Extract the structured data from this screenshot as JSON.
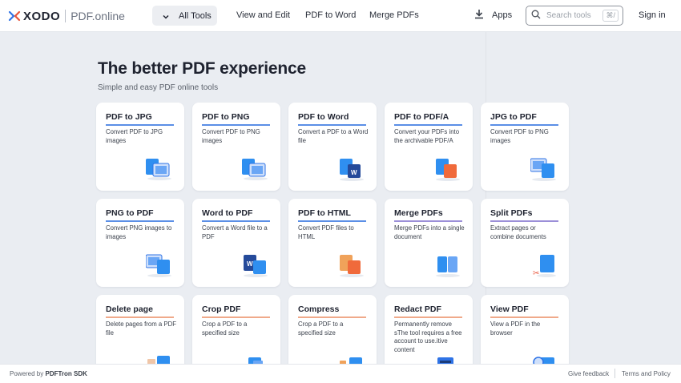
{
  "header": {
    "logo_word": "XODO",
    "logo_product": "PDF.online",
    "all_tools_label": "All Tools",
    "nav_links": [
      "View and Edit",
      "PDF to Word",
      "Merge PDFs"
    ],
    "apps_label": "Apps",
    "search_placeholder": "Search tools",
    "search_shortcut": "⌘/",
    "signin_label": "Sign in",
    "brand_color": "#2f73e6"
  },
  "hero": {
    "title": "The better PDF experience",
    "subtitle": "Simple and easy PDF online tools"
  },
  "tools": [
    {
      "title": "PDF to JPG",
      "desc": "Convert PDF to JPG images",
      "accent": "#5b8fe6",
      "icon": "pdf-to-image-icon"
    },
    {
      "title": "PDF to PNG",
      "desc": "Convert PDF to PNG images",
      "accent": "#5b8fe6",
      "icon": "pdf-to-image-icon"
    },
    {
      "title": "PDF to Word",
      "desc": "Convert a PDF to a Word file",
      "accent": "#5b8fe6",
      "icon": "pdf-to-word-icon"
    },
    {
      "title": "PDF to PDF/A",
      "desc": "Convert your PDFs into the archivable PDF/A",
      "accent": "#5b8fe6",
      "icon": "pdf-to-pdfa-icon"
    },
    {
      "title": "JPG to PDF",
      "desc": "Convert PDF to PNG images",
      "accent": "#5b8fe6",
      "icon": "image-to-pdf-icon"
    },
    {
      "title": "PNG  to PDF",
      "desc": "Convert PNG images to images",
      "accent": "#5b8fe6",
      "icon": "image-to-pdf-icon"
    },
    {
      "title": "Word to PDF",
      "desc": "Convert a Word file to a PDF",
      "accent": "#5b8fe6",
      "icon": "word-to-pdf-icon"
    },
    {
      "title": "PDF to HTML",
      "desc": "Convert PDF files to HTML",
      "accent": "#5b8fe6",
      "icon": "pdf-to-html-icon"
    },
    {
      "title": "Merge PDFs",
      "desc": "Merge PDFs into a single document",
      "accent": "#9b8fd8",
      "icon": "merge-icon"
    },
    {
      "title": "Split PDFs",
      "desc": "Extract pages or combine documents",
      "accent": "#9b8fd8",
      "icon": "split-icon"
    },
    {
      "title": "Delete page",
      "desc": "Delete pages from a PDF file",
      "accent": "#f0a98a",
      "icon": "delete-page-icon"
    },
    {
      "title": "Crop PDF",
      "desc": "Crop a PDF to a specified size",
      "accent": "#f0a98a",
      "icon": "crop-icon"
    },
    {
      "title": "Compress",
      "desc": "Crop a PDF to a specified size",
      "accent": "#f0a98a",
      "icon": "compress-icon"
    },
    {
      "title": "Redact PDF",
      "desc": "Permanently remove sThe tool requires a free account to use.itive content",
      "accent": "#f0a98a",
      "icon": "redact-icon"
    },
    {
      "title": "View PDF",
      "desc": "View a PDF in the browser",
      "accent": "#f0a98a",
      "icon": "view-icon"
    }
  ],
  "footer": {
    "powered_prefix": "Powered by",
    "powered_brand": "PDFTron SDK",
    "feedback": "Give feedback",
    "terms": "Terms and Policy"
  }
}
